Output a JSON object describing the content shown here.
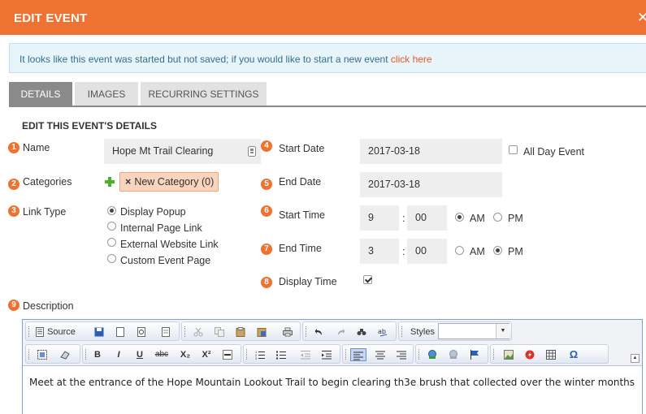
{
  "header": {
    "title": "EDIT EVENT",
    "close_icon": "close-icon",
    "close_glyph": "✕"
  },
  "alert": {
    "message": "It looks like this event was started but not saved; if you would like to start a new event ",
    "link": "click here"
  },
  "tabs": [
    {
      "label": "DETAILS",
      "active": true
    },
    {
      "label": "IMAGES",
      "active": false
    },
    {
      "label": "RECURRING SETTINGS",
      "active": false
    }
  ],
  "section_title": "EDIT THIS EVENT'S DETAILS",
  "fields": {
    "name": {
      "num": "1",
      "label": "Name",
      "value": "Hope Mt Trail Clearing"
    },
    "categories": {
      "num": "2",
      "label": "Categories",
      "tag": "New Category (0)",
      "tag_remove": "×"
    },
    "link_type": {
      "num": "3",
      "label": "Link Type",
      "options": [
        "Display Popup",
        "Internal Page Link",
        "External Website Link",
        "Custom Event Page"
      ],
      "selected": 0
    },
    "start_date": {
      "num": "4",
      "label": "Start Date",
      "value": "2017-03-18",
      "all_day_label": "All Day Event",
      "all_day": false
    },
    "end_date": {
      "num": "5",
      "label": "End Date",
      "value": "2017-03-18"
    },
    "start_time": {
      "num": "6",
      "label": "Start Time",
      "hour": "9",
      "minute": "00",
      "am": "AM",
      "pm": "PM",
      "selected": "AM"
    },
    "end_time": {
      "num": "7",
      "label": "End Time",
      "hour": "3",
      "minute": "00",
      "am": "AM",
      "pm": "PM",
      "selected": "PM"
    },
    "display_time": {
      "num": "8",
      "label": "Display Time",
      "checked": true
    },
    "description": {
      "num": "9",
      "label": "Description"
    }
  },
  "editor": {
    "source_label": "Source",
    "styles_label": "Styles",
    "bold": "B",
    "italic": "I",
    "underline": "U",
    "strike": "abc",
    "subscript": "X₂",
    "superscript": "X²",
    "omega": "Ω",
    "content": "Meet at the entrance of the Hope Mountain Lookout Trail to begin clearing th3e brush that collected over the winter months"
  },
  "colors": {
    "accent": "#ee7231",
    "alert_bg": "#e7f4f9",
    "tab_active": "#8a8a8a"
  }
}
